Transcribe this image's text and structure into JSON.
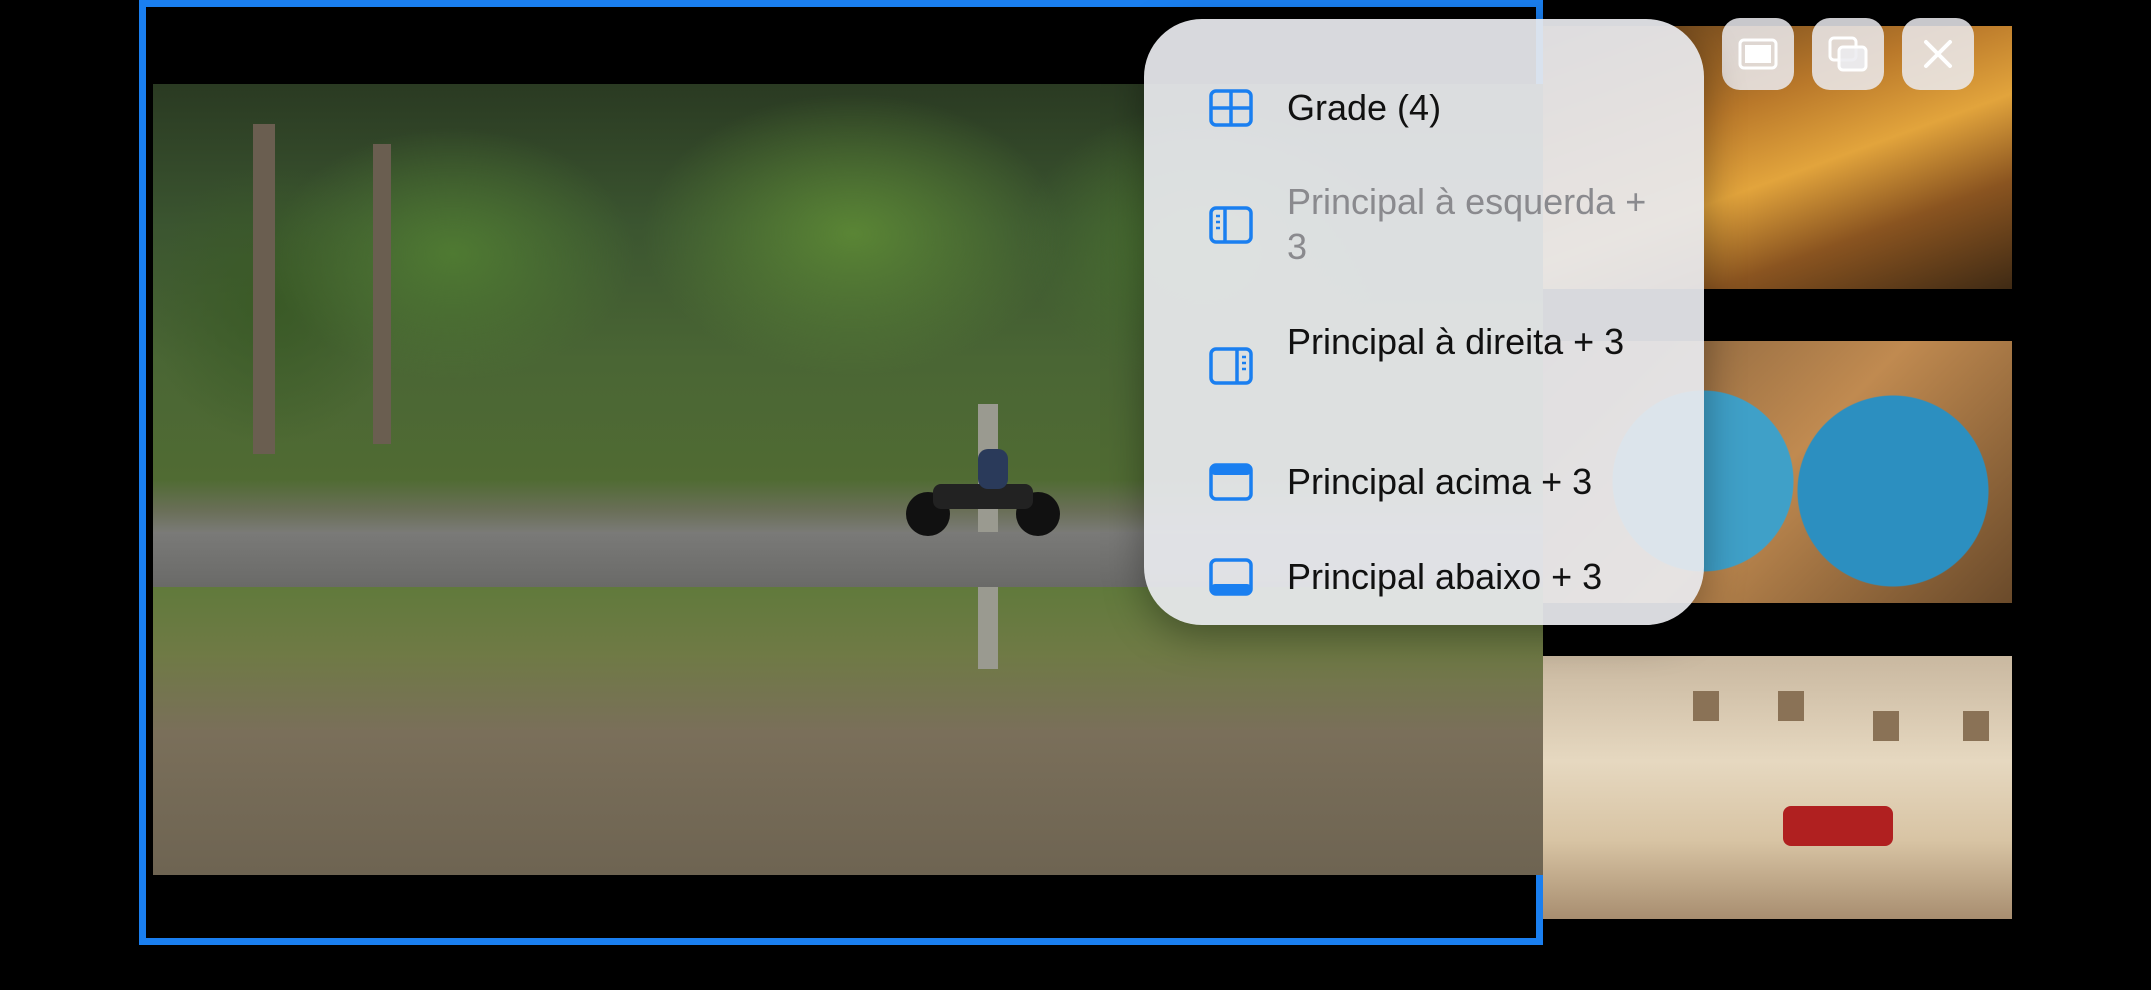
{
  "layout_menu": {
    "items": [
      {
        "label": "Grade (4)",
        "enabled": true
      },
      {
        "label": "Principal à esquerda + 3",
        "enabled": false
      },
      {
        "label": "Principal à direita + 3",
        "enabled": true
      },
      {
        "label": "Principal acima + 3",
        "enabled": true
      },
      {
        "label": "Principal abaixo + 3",
        "enabled": true
      }
    ]
  },
  "controls": {
    "single_view_icon": "single-view-icon",
    "picture_in_picture_icon": "picture-in-picture-icon",
    "close_icon": "close-icon"
  },
  "colors": {
    "selection_border": "#1a7ff0",
    "menu_icon": "#1a7ff0",
    "menu_background": "#e8eaee"
  }
}
